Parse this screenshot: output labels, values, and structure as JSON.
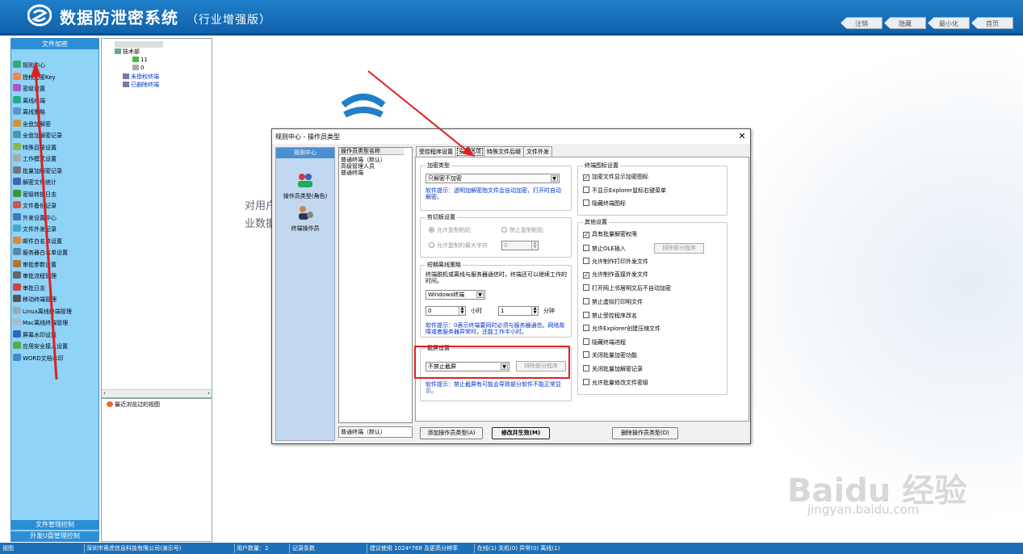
{
  "app": {
    "title": "数据防泄密系统",
    "subtitle": "（行业增强版）",
    "header_buttons": [
      "注销",
      "隐藏",
      "最小化",
      "首页"
    ]
  },
  "sidebar": {
    "header": "文件加密",
    "items": [
      "规则中心",
      "授权加密Key",
      "密级设置",
      "离线终端",
      "离线策略",
      "全盘加解密",
      "全盘加解密记录",
      "特殊目录设置",
      "工作模式设置",
      "批量加解密记录",
      "解密文件统计",
      "密级转换日志",
      "文件备份记录",
      "外发设置中心",
      "文件外发记录",
      "邮件白名单设置",
      "服务器白名单设置",
      "审批参数设置",
      "审批流程管理",
      "审批日志",
      "移动终端管理",
      "Linux离线终端管理",
      "Mac离线终端管理",
      "屏幕水印设置",
      "应用安全接入设置",
      "WORD文档水印"
    ],
    "footer1": "文件管理控制",
    "footer2": "外发U盘管理控制"
  },
  "tree": {
    "root": "技术部",
    "child1": "11",
    "child2": "0",
    "unauthorized": "未授权终端",
    "deleted": "已删除终端",
    "recent": "最近浏览过的视图"
  },
  "background": {
    "line1": "对用户",
    "line2": "业数据"
  },
  "watermark": {
    "brand": "Baidu 经验",
    "url": "jingyan.baidu.com"
  },
  "statusbar": {
    "view": "视图",
    "company": "深圳市蓉虎信息科技有限公司(演示号)",
    "users": "用户数量：2",
    "records": "记录条数",
    "resolution": "建议使用 1024*768 及更高分辨率",
    "online": "在线(1) 关机(0) 异常(0) 离线(1)"
  },
  "dialog": {
    "title": "规则中心 - 操作员类型",
    "close": "✕",
    "left_header": "规则中心",
    "nav_role": "操作员类型(角色)",
    "nav_terminal": "终端操作员",
    "type_list_header": "操作员类型名称",
    "type_items": [
      "普通终端（默认）",
      "高级管理人员",
      "普通终端"
    ],
    "type_input": "普通终端（默认）",
    "tabs": [
      "受控程序设置",
      "安全选项",
      "特殊文件后缀",
      "文件外发"
    ],
    "encrypt_group": {
      "title": "加密类型",
      "value": "只解密不加密",
      "hint": "软件提示：透明加解密指文件会自动加密，打开时自动解密。"
    },
    "clipboard_group": {
      "title": "剪切板设置",
      "opt_allow": "允许复制粘贴",
      "opt_forbid": "禁止复制粘贴",
      "opt_max": "允许复制的最大字符",
      "max_value": "0"
    },
    "offline_group": {
      "title": "短期离线策略",
      "desc": "终端脱机或离线与服务器通信时，终端还可以继续工作的时间。",
      "os_value": "Windows终端",
      "hours_value": "0",
      "hours_label": "小时",
      "minutes_value": "1",
      "minutes_label": "分钟",
      "hint": "软件提示：0表示终端要同时必须与服务器通信。网络故障或者服务器异常时，还能工作半小时。"
    },
    "screen_group": {
      "title": "截屏设置",
      "value": "不禁止截屏",
      "exclude_button": "排除部分程序",
      "hint": "软件提示：禁止截屏有可能会导致部分软件不能正常显示。"
    },
    "icon_group": {
      "title": "终端图标设置",
      "items": [
        {
          "label": "加密文件显示加密图标",
          "checked": true
        },
        {
          "label": "不显示Explorer鼠标右键菜单",
          "checked": false
        },
        {
          "label": "隐藏终端图标",
          "checked": false
        }
      ]
    },
    "other_group": {
      "title": "其他设置",
      "ole_exclude_button": "排除部分程序",
      "items": [
        {
          "label": "具有批量解密权限",
          "checked": true
        },
        {
          "label": "禁止OLE插入",
          "checked": false
        },
        {
          "label": "允许制作打印外发文件",
          "checked": false
        },
        {
          "label": "允许制作直接外发文件",
          "checked": true
        },
        {
          "label": "打开网上邻居明文后不自动加密",
          "checked": false
        },
        {
          "label": "禁止虚拟打印明文件",
          "checked": false
        },
        {
          "label": "禁止受控程序改名",
          "checked": false
        },
        {
          "label": "允许Explorer创建压缩文件",
          "checked": false
        },
        {
          "label": "隐藏终端进程",
          "checked": false
        },
        {
          "label": "关闭批量加密功能",
          "checked": false
        },
        {
          "label": "关闭批量加解密记录",
          "checked": false
        },
        {
          "label": "允许批量修改文件密级",
          "checked": false
        }
      ]
    },
    "buttons": {
      "add": "添加操作员类型(A)",
      "save": "修改并生效(M)",
      "delete": "删除操作员类型(D)"
    }
  },
  "colors": {
    "header": "#1f7fc9",
    "sidebar": "#8fd3f7",
    "highlight": "#e02020",
    "hint_text": "#0033cc"
  }
}
